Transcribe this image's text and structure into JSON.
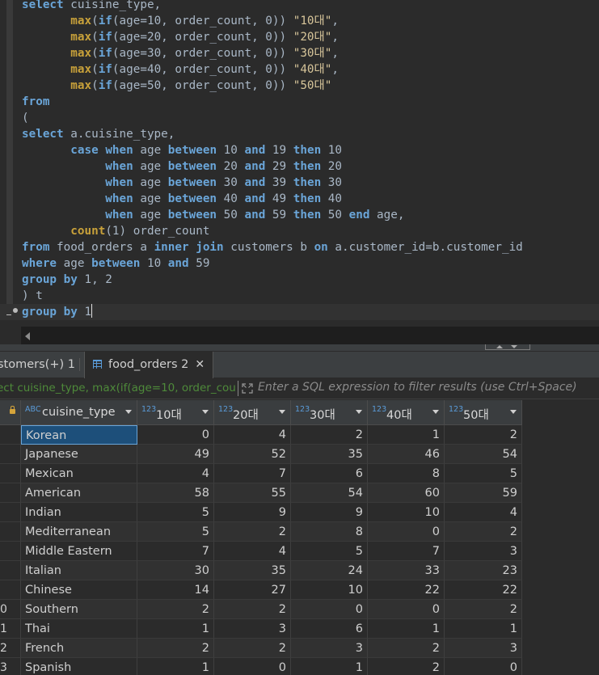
{
  "editor": {
    "lines": [
      [
        [
          "kw",
          "select"
        ],
        [
          "plain",
          " cuisine_type,"
        ]
      ],
      [
        [
          "plain",
          "       "
        ],
        [
          "fn",
          "max"
        ],
        [
          "plain",
          "("
        ],
        [
          "kw",
          "if"
        ],
        [
          "plain",
          "(age=10, order_count, 0)) "
        ],
        [
          "str",
          "\"10대\""
        ],
        [
          "plain",
          ","
        ]
      ],
      [
        [
          "plain",
          "       "
        ],
        [
          "fn",
          "max"
        ],
        [
          "plain",
          "("
        ],
        [
          "kw",
          "if"
        ],
        [
          "plain",
          "(age=20, order_count, 0)) "
        ],
        [
          "str",
          "\"20대\""
        ],
        [
          "plain",
          ","
        ]
      ],
      [
        [
          "plain",
          "       "
        ],
        [
          "fn",
          "max"
        ],
        [
          "plain",
          "("
        ],
        [
          "kw",
          "if"
        ],
        [
          "plain",
          "(age=30, order_count, 0)) "
        ],
        [
          "str",
          "\"30대\""
        ],
        [
          "plain",
          ","
        ]
      ],
      [
        [
          "plain",
          "       "
        ],
        [
          "fn",
          "max"
        ],
        [
          "plain",
          "("
        ],
        [
          "kw",
          "if"
        ],
        [
          "plain",
          "(age=40, order_count, 0)) "
        ],
        [
          "str",
          "\"40대\""
        ],
        [
          "plain",
          ","
        ]
      ],
      [
        [
          "plain",
          "       "
        ],
        [
          "fn",
          "max"
        ],
        [
          "plain",
          "("
        ],
        [
          "kw",
          "if"
        ],
        [
          "plain",
          "(age=50, order_count, 0)) "
        ],
        [
          "str",
          "\"50대\""
        ]
      ],
      [
        [
          "kw",
          "from"
        ]
      ],
      [
        [
          "plain",
          "("
        ]
      ],
      [
        [
          "kw",
          "select"
        ],
        [
          "plain",
          " a.cuisine_type,"
        ]
      ],
      [
        [
          "plain",
          "       "
        ],
        [
          "kw",
          "case"
        ],
        [
          "plain",
          " "
        ],
        [
          "kw",
          "when"
        ],
        [
          "plain",
          " age "
        ],
        [
          "kw",
          "between"
        ],
        [
          "plain",
          " 10 "
        ],
        [
          "kw",
          "and"
        ],
        [
          "plain",
          " 19 "
        ],
        [
          "kw",
          "then"
        ],
        [
          "plain",
          " 10"
        ]
      ],
      [
        [
          "plain",
          "            "
        ],
        [
          "kw",
          "when"
        ],
        [
          "plain",
          " age "
        ],
        [
          "kw",
          "between"
        ],
        [
          "plain",
          " 20 "
        ],
        [
          "kw",
          "and"
        ],
        [
          "plain",
          " 29 "
        ],
        [
          "kw",
          "then"
        ],
        [
          "plain",
          " 20"
        ]
      ],
      [
        [
          "plain",
          "            "
        ],
        [
          "kw",
          "when"
        ],
        [
          "plain",
          " age "
        ],
        [
          "kw",
          "between"
        ],
        [
          "plain",
          " 30 "
        ],
        [
          "kw",
          "and"
        ],
        [
          "plain",
          " 39 "
        ],
        [
          "kw",
          "then"
        ],
        [
          "plain",
          " 30"
        ]
      ],
      [
        [
          "plain",
          "            "
        ],
        [
          "kw",
          "when"
        ],
        [
          "plain",
          " age "
        ],
        [
          "kw",
          "between"
        ],
        [
          "plain",
          " 40 "
        ],
        [
          "kw",
          "and"
        ],
        [
          "plain",
          " 49 "
        ],
        [
          "kw",
          "then"
        ],
        [
          "plain",
          " 40"
        ]
      ],
      [
        [
          "plain",
          "            "
        ],
        [
          "kw",
          "when"
        ],
        [
          "plain",
          " age "
        ],
        [
          "kw",
          "between"
        ],
        [
          "plain",
          " 50 "
        ],
        [
          "kw",
          "and"
        ],
        [
          "plain",
          " 59 "
        ],
        [
          "kw",
          "then"
        ],
        [
          "plain",
          " 50 "
        ],
        [
          "kw",
          "end"
        ],
        [
          "plain",
          " age,"
        ]
      ],
      [
        [
          "plain",
          "       "
        ],
        [
          "fn",
          "count"
        ],
        [
          "plain",
          "(1) order_count"
        ]
      ],
      [
        [
          "kw",
          "from"
        ],
        [
          "plain",
          " food_orders a "
        ],
        [
          "kw",
          "inner"
        ],
        [
          "plain",
          " "
        ],
        [
          "kw",
          "join"
        ],
        [
          "plain",
          " customers b "
        ],
        [
          "kw",
          "on"
        ],
        [
          "plain",
          " a.customer_id=b.customer_id"
        ]
      ],
      [
        [
          "kw",
          "where"
        ],
        [
          "plain",
          " age "
        ],
        [
          "kw",
          "between"
        ],
        [
          "plain",
          " 10 "
        ],
        [
          "kw",
          "and"
        ],
        [
          "plain",
          " 59"
        ]
      ],
      [
        [
          "kw",
          "group"
        ],
        [
          "plain",
          " "
        ],
        [
          "kw",
          "by"
        ],
        [
          "plain",
          " 1, 2"
        ]
      ],
      [
        [
          "plain",
          ") t"
        ]
      ],
      [
        [
          "kw",
          "group"
        ],
        [
          "plain",
          " "
        ],
        [
          "kw",
          "by"
        ],
        [
          "plain",
          " 1"
        ]
      ]
    ]
  },
  "tabs": [
    {
      "label": "stomers(+) 1"
    },
    {
      "label": "food_orders 2"
    }
  ],
  "filter": {
    "query": "ect cuisine_type, max(if(age=10, order_cou",
    "placeholder": "Enter a SQL expression to filter results (use Ctrl+Space)"
  },
  "grid": {
    "columns": [
      {
        "type": "ABC",
        "label": "cuisine_type"
      },
      {
        "type": "123",
        "label": "10대"
      },
      {
        "type": "123",
        "label": "20대"
      },
      {
        "type": "123",
        "label": "30대"
      },
      {
        "type": "123",
        "label": "40대"
      },
      {
        "type": "123",
        "label": "50대"
      }
    ],
    "rows": [
      {
        "num": "",
        "cells": [
          "Korean",
          "0",
          "4",
          "2",
          "1",
          "2"
        ]
      },
      {
        "num": "",
        "cells": [
          "Japanese",
          "49",
          "52",
          "35",
          "46",
          "54"
        ]
      },
      {
        "num": "",
        "cells": [
          "Mexican",
          "4",
          "7",
          "6",
          "8",
          "5"
        ]
      },
      {
        "num": "",
        "cells": [
          "American",
          "58",
          "55",
          "54",
          "60",
          "59"
        ]
      },
      {
        "num": "",
        "cells": [
          "Indian",
          "5",
          "9",
          "9",
          "10",
          "4"
        ]
      },
      {
        "num": "",
        "cells": [
          "Mediterranean",
          "5",
          "2",
          "8",
          "0",
          "2"
        ]
      },
      {
        "num": "",
        "cells": [
          "Middle Eastern",
          "7",
          "4",
          "5",
          "7",
          "3"
        ]
      },
      {
        "num": "",
        "cells": [
          "Italian",
          "30",
          "35",
          "24",
          "33",
          "23"
        ]
      },
      {
        "num": "",
        "cells": [
          "Chinese",
          "14",
          "27",
          "10",
          "22",
          "22"
        ]
      },
      {
        "num": "0",
        "cells": [
          "Southern",
          "2",
          "2",
          "0",
          "0",
          "2"
        ]
      },
      {
        "num": "1",
        "cells": [
          "Thai",
          "1",
          "3",
          "6",
          "1",
          "1"
        ]
      },
      {
        "num": "2",
        "cells": [
          "French",
          "2",
          "2",
          "3",
          "2",
          "3"
        ]
      },
      {
        "num": "3",
        "cells": [
          "Spanish",
          "1",
          "0",
          "1",
          "2",
          "0"
        ]
      }
    ]
  }
}
